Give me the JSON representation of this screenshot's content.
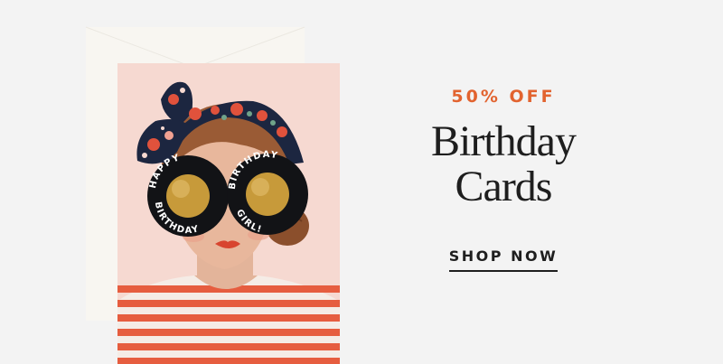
{
  "promo": {
    "discount": "50% OFF",
    "headline_line1": "Birthday",
    "headline_line2": "Cards",
    "cta_label": "SHOP NOW"
  },
  "card": {
    "sunglasses_left_text": "HAPPY BIRTHDAY",
    "sunglasses_right_text": "BIRTHDAY GIRL!"
  },
  "colors": {
    "background": "#f3f3f3",
    "card": "#f6d9d1",
    "accent": "#e2632f",
    "stripe": "#e65d3f",
    "headband": "#1c2640",
    "hair": "#9a5b35",
    "lens_gold": "#c79a3a",
    "text_dark": "#1e1e1e"
  }
}
